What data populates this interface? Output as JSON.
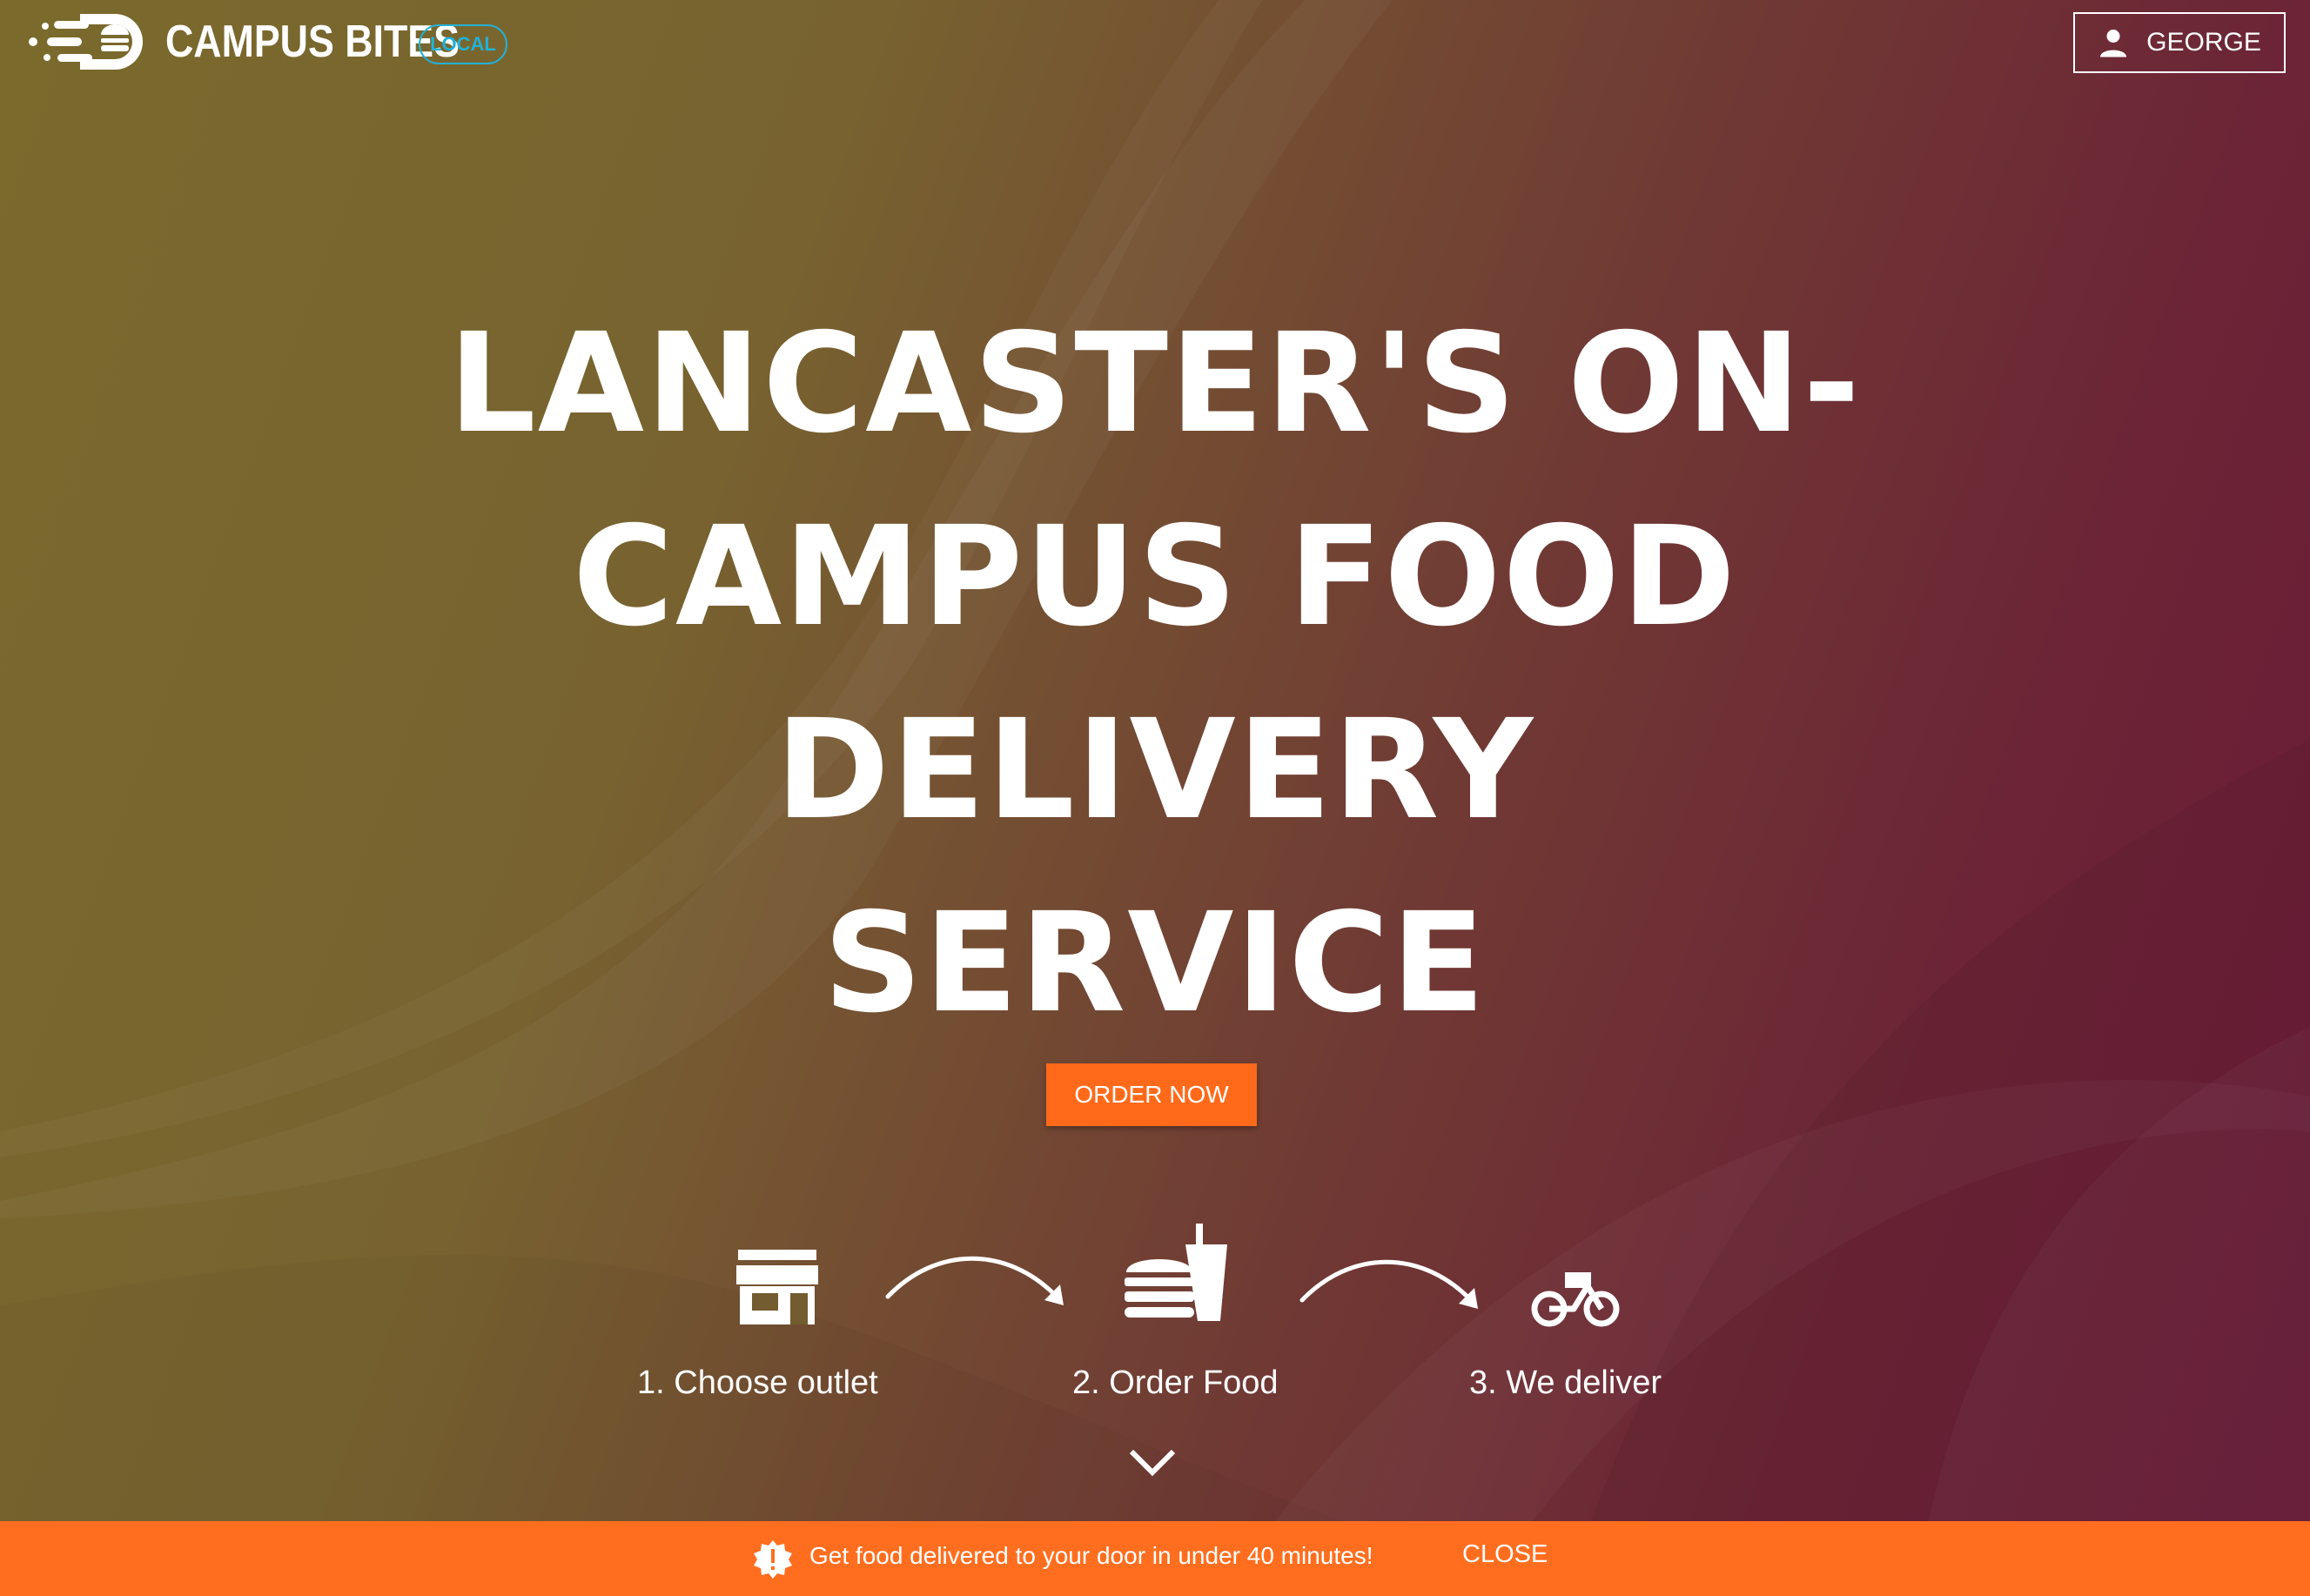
{
  "header": {
    "brand": "CAMPUS BITES",
    "badge": "LOCAL",
    "user_name": "GEORGE",
    "icons": [
      "campus-bites-logo",
      "user-icon"
    ]
  },
  "hero": {
    "title_lines": [
      "LANCASTER'S ON-",
      "CAMPUS FOOD",
      "DELIVERY",
      "SERVICE"
    ],
    "cta_label": "ORDER NOW"
  },
  "steps": [
    {
      "label": "1. Choose outlet",
      "icon": "storefront-icon"
    },
    {
      "label": "2. Order Food",
      "icon": "burger-drink-icon"
    },
    {
      "label": "3. We deliver",
      "icon": "bike-icon"
    }
  ],
  "banner": {
    "message": "Get food delivered to your door in under 40 minutes!",
    "close_label": "CLOSE",
    "icon": "alert-icon"
  },
  "colors": {
    "accent_orange": "#ff6a1a",
    "badge_cyan": "#22b1d6",
    "bg_olive": "#7a6a2c",
    "bg_maroon": "#6a1a38"
  }
}
